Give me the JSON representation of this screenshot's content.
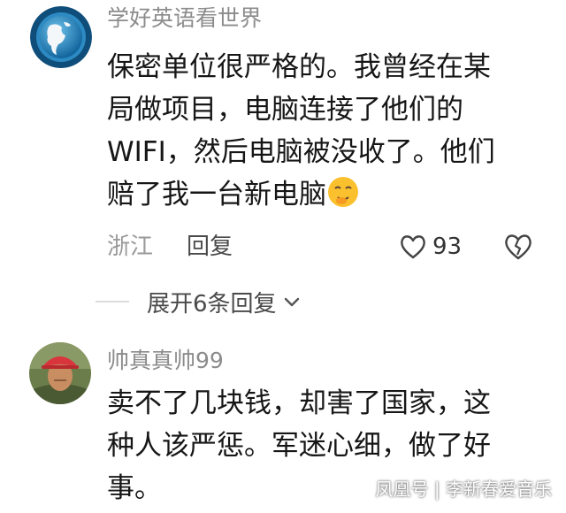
{
  "comments": [
    {
      "username": "学好英语看世界",
      "body_lines": [
        "保密单位很严格的。我曾经在某",
        "局做项目，电脑连接了他们的",
        "WIFI，然后电脑被没收了。他们",
        "赔了我一台新电脑"
      ],
      "emoji": "shushing-face-emoji",
      "location": "浙江",
      "reply_label": "回复",
      "like_count": "93"
    },
    {
      "username": "帅真真帅99",
      "body_lines": [
        "卖不了几块钱，却害了国家，这",
        "种人该严惩。军迷心细，做了好",
        "事。"
      ]
    }
  ],
  "expand_replies_label": "展开6条回复",
  "watermark": "凤凰号 | 李新春爱音乐",
  "icons": [
    "globe-avatar-icon",
    "heart-icon",
    "broken-heart-icon",
    "chevron-down-icon"
  ],
  "colors": {
    "username": "#8c8c8c",
    "text": "#161616",
    "meta": "#9a9a9a"
  }
}
